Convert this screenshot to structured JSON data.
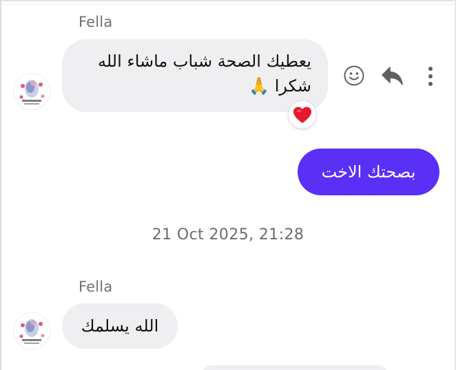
{
  "messages": [
    {
      "sender": "Fella",
      "line1": "يعطيك الصحة شباب ماشاء الله",
      "line2": "شكرا 🙏",
      "reaction": "heart"
    },
    {
      "outgoing_text": "بصحتك الاخت"
    },
    {
      "timestamp": "21 Oct 2025, 21:28"
    },
    {
      "sender": "Fella",
      "text": "الله يسلمك"
    }
  ],
  "icons": {
    "emoji": "smiley-icon",
    "reply": "reply-icon",
    "more": "more-vertical-icon",
    "reaction": "heart-icon",
    "avatar": "avatar-image"
  },
  "colors": {
    "incoming_bubble": "#efeff1",
    "outgoing_bubble": "#5a2ff6",
    "sender_name": "#707070",
    "timestamp": "#6b6b6b",
    "heart": "#e8192c"
  }
}
